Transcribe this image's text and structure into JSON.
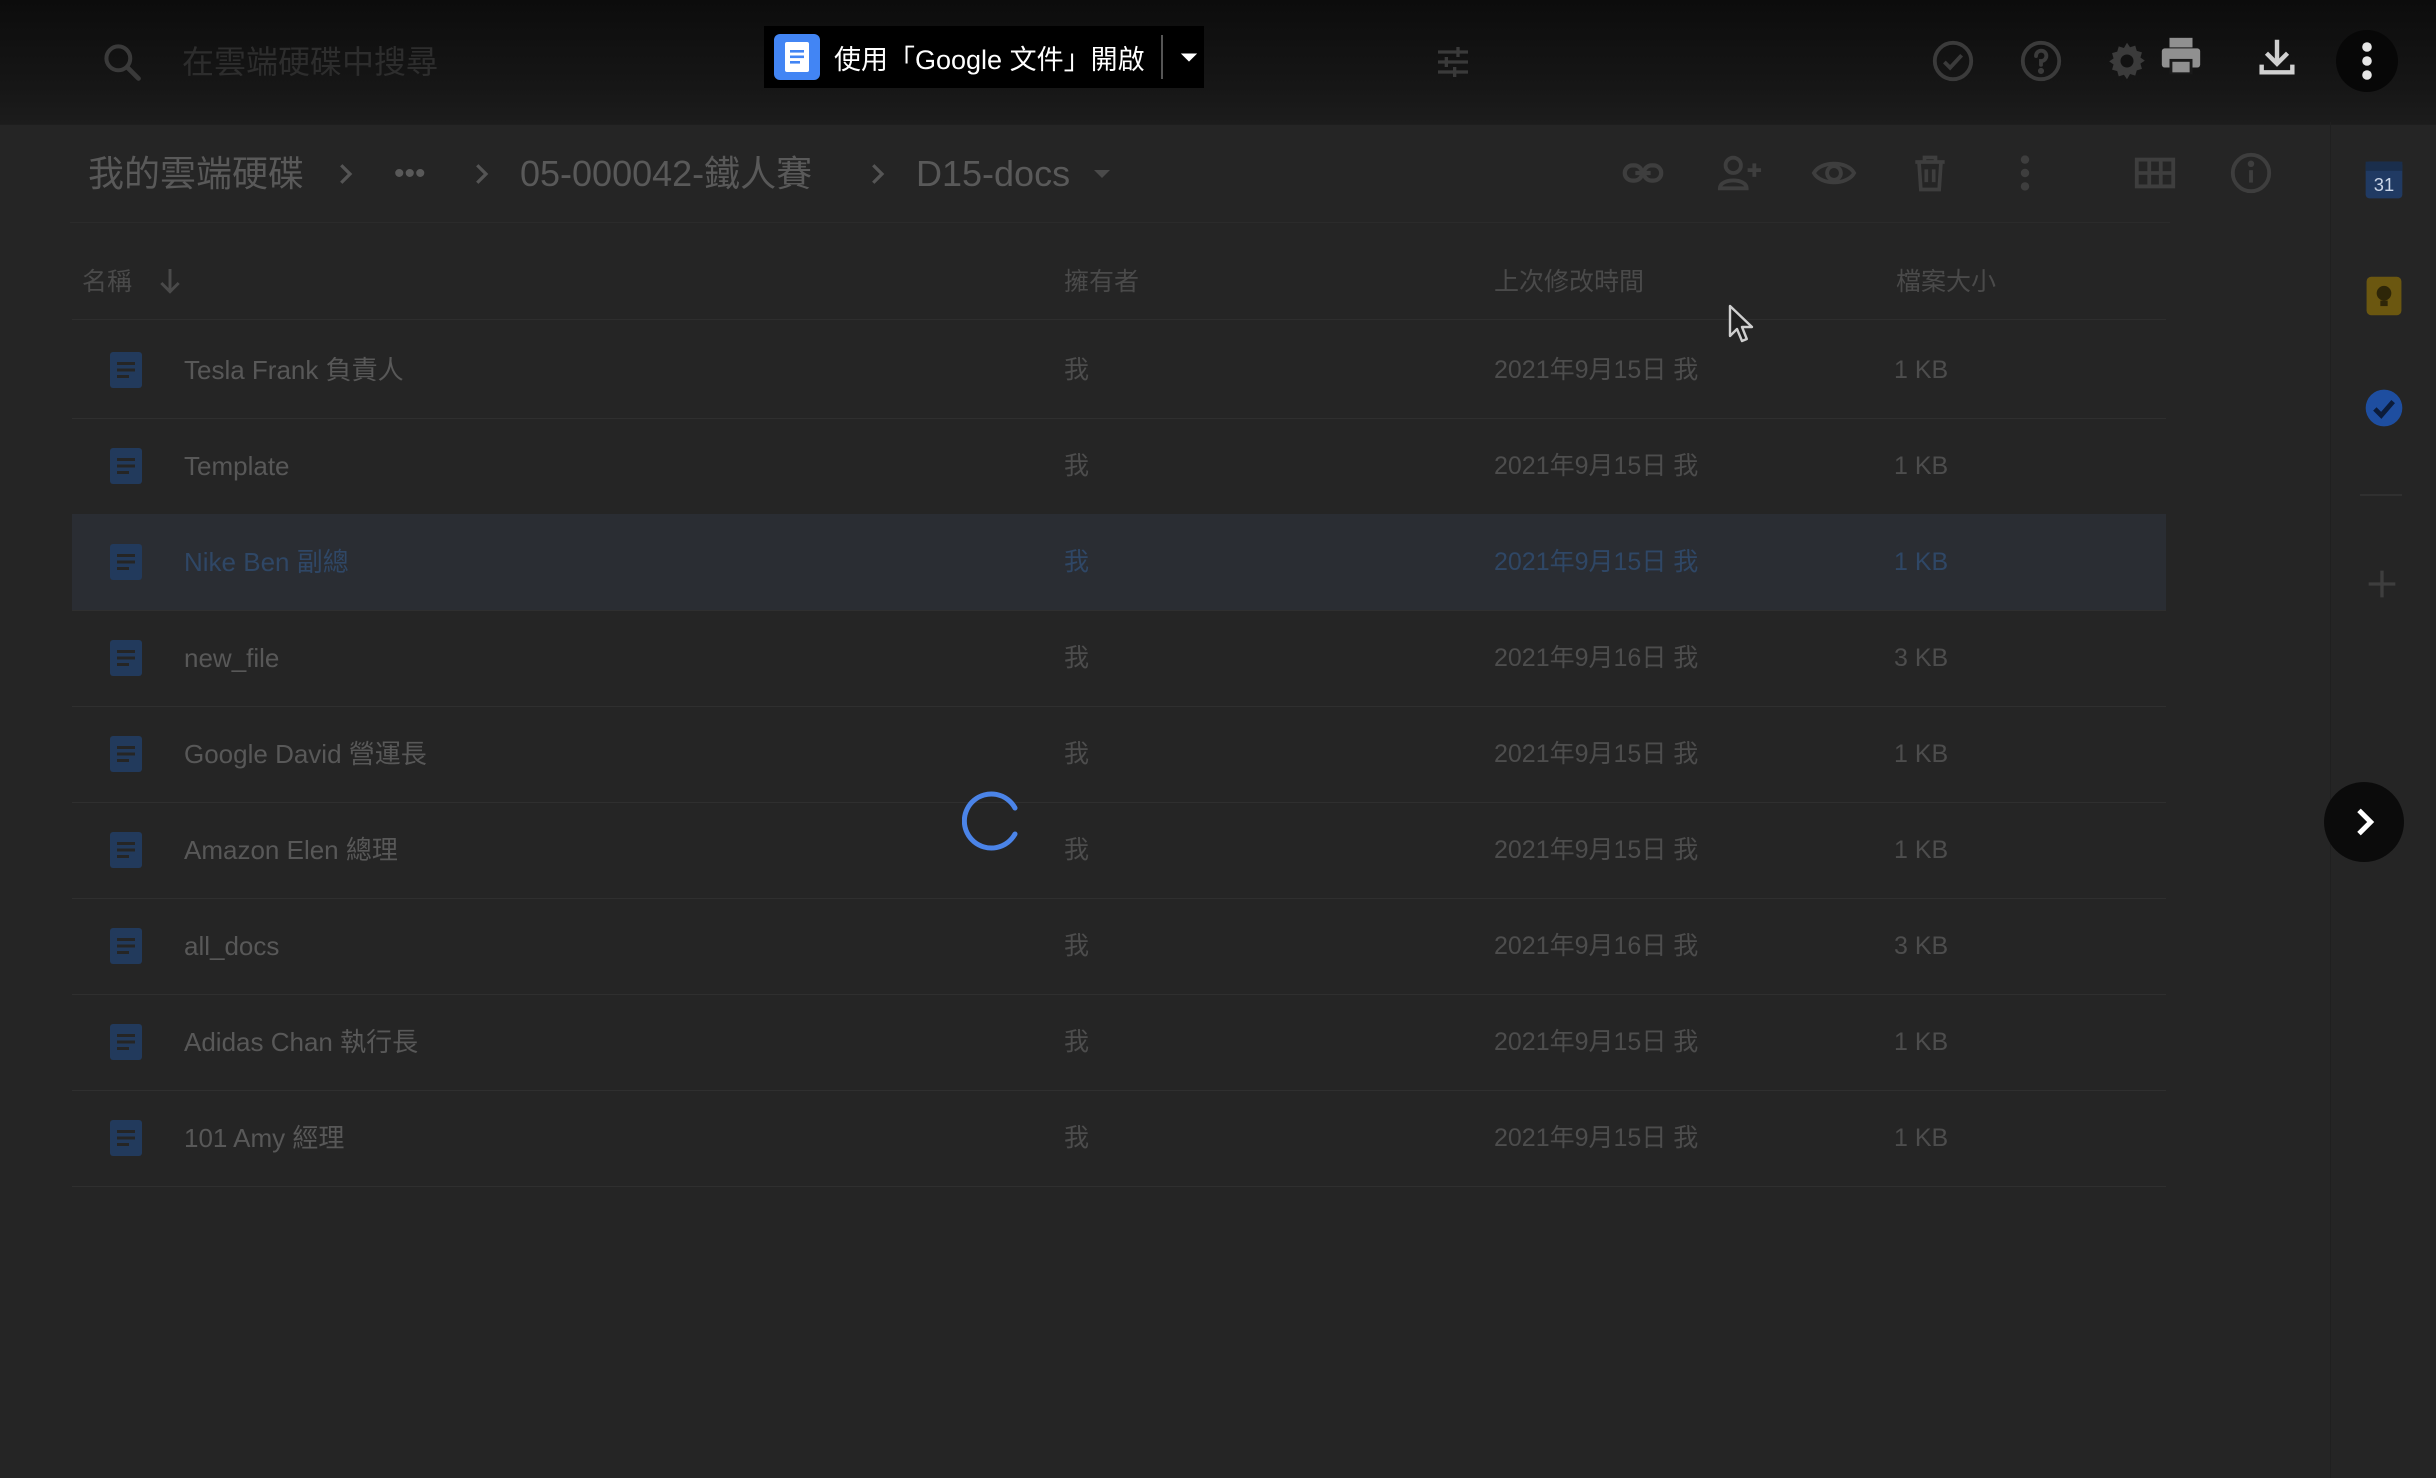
{
  "search": {
    "placeholder": "在雲端硬碟中搜尋"
  },
  "open_with": {
    "label": "使用「Google 文件」開啟"
  },
  "breadcrumb": {
    "root": "我的雲端硬碟",
    "ellipsis": "•••",
    "parent": "05-000042-鐵人賽",
    "current": "D15-docs"
  },
  "columns": {
    "name": "名稱",
    "owner": "擁有者",
    "modified": "上次修改時間",
    "size": "檔案大小"
  },
  "files": [
    {
      "name": "Tesla Frank 負責人",
      "owner": "我",
      "modified": "2021年9月15日 我",
      "size": "1 KB"
    },
    {
      "name": "Template",
      "owner": "我",
      "modified": "2021年9月15日 我",
      "size": "1 KB"
    },
    {
      "name": "Nike Ben 副總",
      "owner": "我",
      "modified": "2021年9月15日 我",
      "size": "1 KB",
      "selected": true
    },
    {
      "name": "new_file",
      "owner": "我",
      "modified": "2021年9月16日 我",
      "size": "3 KB"
    },
    {
      "name": "Google David 營運長",
      "owner": "我",
      "modified": "2021年9月15日 我",
      "size": "1 KB"
    },
    {
      "name": "Amazon Elen 總理",
      "owner": "我",
      "modified": "2021年9月15日 我",
      "size": "1 KB"
    },
    {
      "name": "all_docs",
      "owner": "我",
      "modified": "2021年9月16日 我",
      "size": "3 KB"
    },
    {
      "name": "Adidas Chan 執行長",
      "owner": "我",
      "modified": "2021年9月15日 我",
      "size": "1 KB"
    },
    {
      "name": "101 Amy 經理",
      "owner": "我",
      "modified": "2021年9月15日 我",
      "size": "1 KB"
    }
  ],
  "side_panel": {
    "calendar_day": "31"
  },
  "colors": {
    "background": "#252525",
    "docs_blue": "#4285f4",
    "file_icon": "#223a5c",
    "selected_row": "#2a2d33",
    "spinner": "#4b84e8"
  },
  "icons": {
    "search": "search-icon",
    "tune": "tune-icon",
    "check_circle": "check-circle-icon",
    "help": "help-icon",
    "settings": "gear-icon",
    "print": "print-icon",
    "download": "download-icon",
    "more": "more-vert-icon",
    "link": "link-icon",
    "share": "person-add-icon",
    "preview": "eye-icon",
    "delete": "trash-icon",
    "grid": "grid-view-icon",
    "info": "info-icon"
  }
}
